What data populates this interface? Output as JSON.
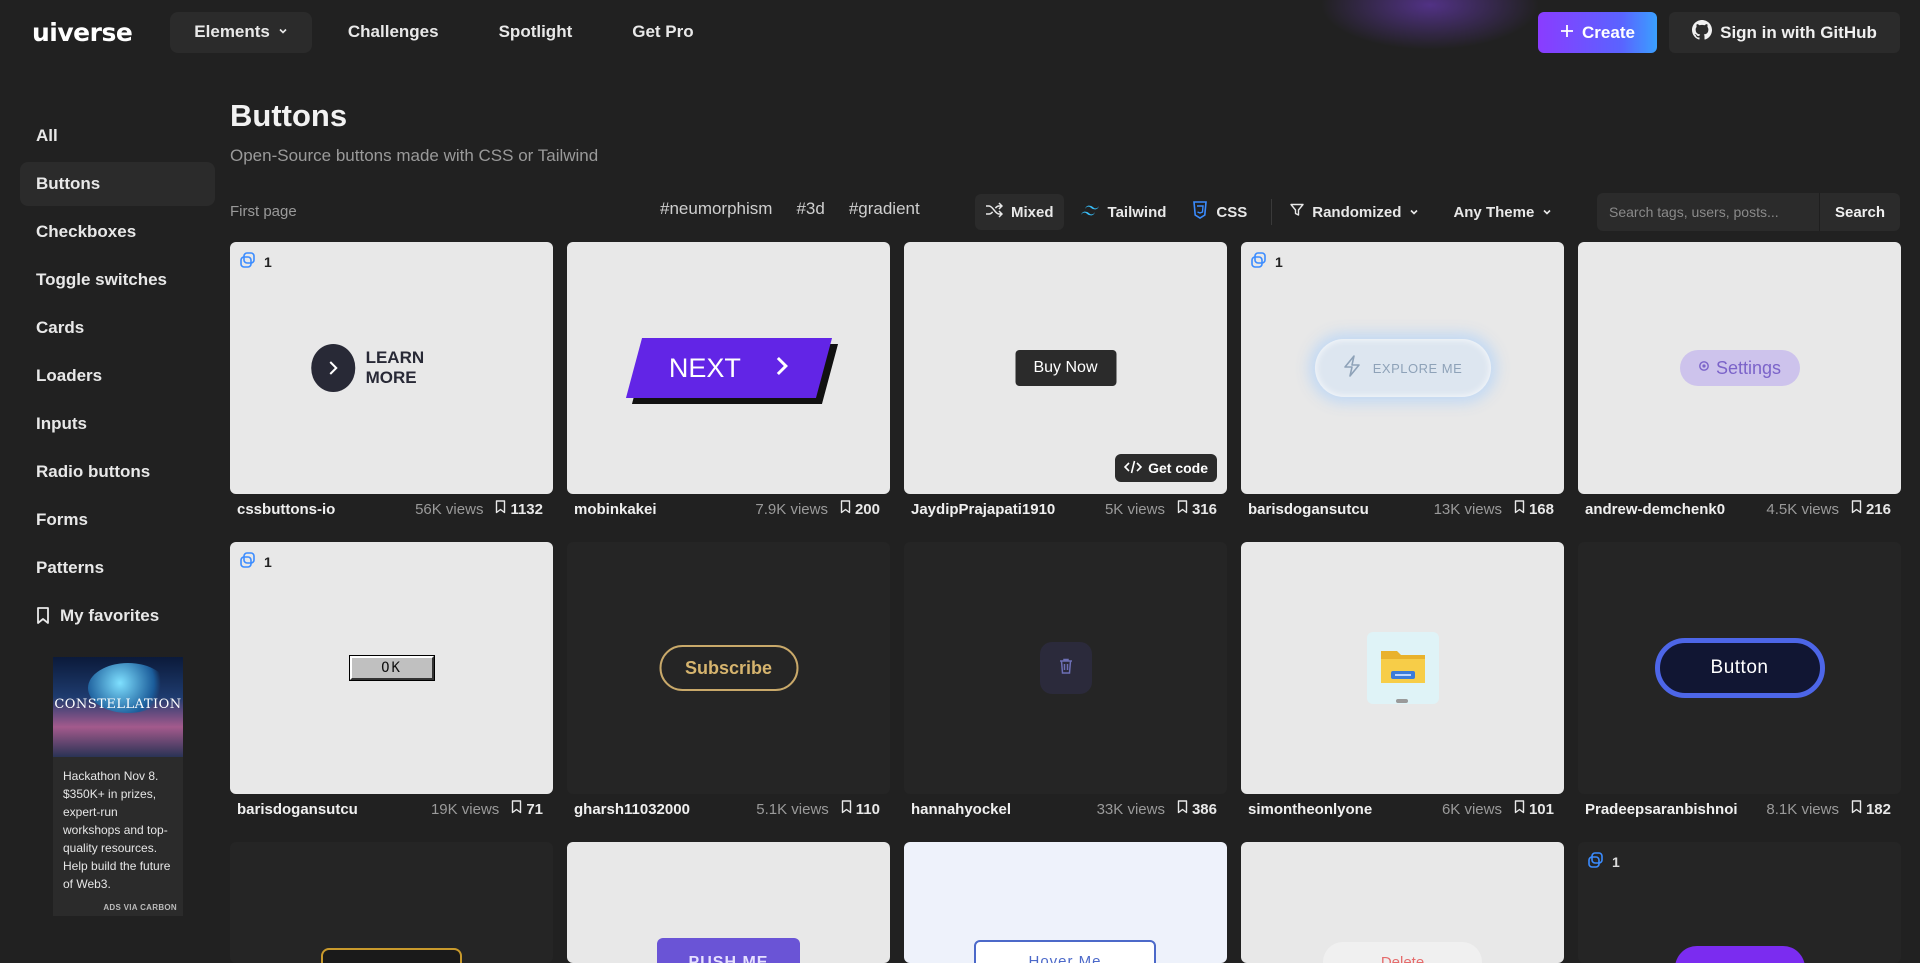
{
  "brand": {
    "logo": "uiverse"
  },
  "nav": {
    "items": [
      {
        "label": "Elements",
        "dropdown": true
      },
      {
        "label": "Challenges"
      },
      {
        "label": "Spotlight"
      },
      {
        "label": "Get Pro"
      }
    ],
    "create_label": "Create",
    "github_label": "Sign in with GitHub"
  },
  "sidebar": {
    "items": [
      {
        "label": "All"
      },
      {
        "label": "Buttons",
        "active": true
      },
      {
        "label": "Checkboxes"
      },
      {
        "label": "Toggle switches"
      },
      {
        "label": "Cards"
      },
      {
        "label": "Loaders"
      },
      {
        "label": "Inputs"
      },
      {
        "label": "Radio buttons"
      },
      {
        "label": "Forms"
      },
      {
        "label": "Patterns"
      }
    ],
    "favorites_label": "My favorites"
  },
  "ad": {
    "image_title": "CONSTELLATION",
    "text": "Hackathon Nov 8. $350K+ in prizes, expert-run workshops and top-quality resources. Help build the future of Web3.",
    "footer": "ADS VIA CARBON"
  },
  "header": {
    "title": "Buttons",
    "subtitle": "Open-Source buttons made with CSS or Tailwind"
  },
  "filterbar": {
    "first_page": "First page",
    "tags": [
      "#neumorphism",
      "#3d",
      "#gradient"
    ],
    "mixed_label": "Mixed",
    "tailwind_label": "Tailwind",
    "css_label": "CSS",
    "sort_label": "Randomized",
    "theme_label": "Any Theme",
    "search_placeholder": "Search tags, users, posts...",
    "search_button": "Search"
  },
  "cards": [
    {
      "user": "cssbuttons-io",
      "views": "56K views",
      "saves": "1132",
      "copies": "1",
      "preview": "LEARN MORE"
    },
    {
      "user": "mobinkakei",
      "views": "7.9K views",
      "saves": "200",
      "preview": "NEXT"
    },
    {
      "user": "JaydipPrajapati1910",
      "views": "5K views",
      "saves": "316",
      "preview": "Buy Now",
      "getcode": "Get code"
    },
    {
      "user": "barisdogansutcu",
      "views": "13K views",
      "saves": "168",
      "copies": "1",
      "preview": "EXPLORE ME"
    },
    {
      "user": "andrew-demchenk0",
      "views": "4.5K views",
      "saves": "216",
      "preview": "Settings"
    },
    {
      "user": "barisdogansutcu",
      "views": "19K views",
      "saves": "71",
      "copies": "1",
      "preview": "OK"
    },
    {
      "user": "gharsh11032000",
      "views": "5.1K views",
      "saves": "110",
      "preview": "Subscribe"
    },
    {
      "user": "hannahyockel",
      "views": "33K views",
      "saves": "386",
      "preview": ""
    },
    {
      "user": "simontheonlyone",
      "views": "6K views",
      "saves": "101",
      "preview": ""
    },
    {
      "user": "Pradeepsaranbishnoi",
      "views": "8.1K views",
      "saves": "182",
      "preview": "Button"
    },
    {
      "preview": ""
    },
    {
      "preview": "PUSH ME"
    },
    {
      "preview": "Hover Me"
    },
    {
      "preview": "Delete"
    },
    {
      "copies": "1",
      "preview": ""
    }
  ]
}
